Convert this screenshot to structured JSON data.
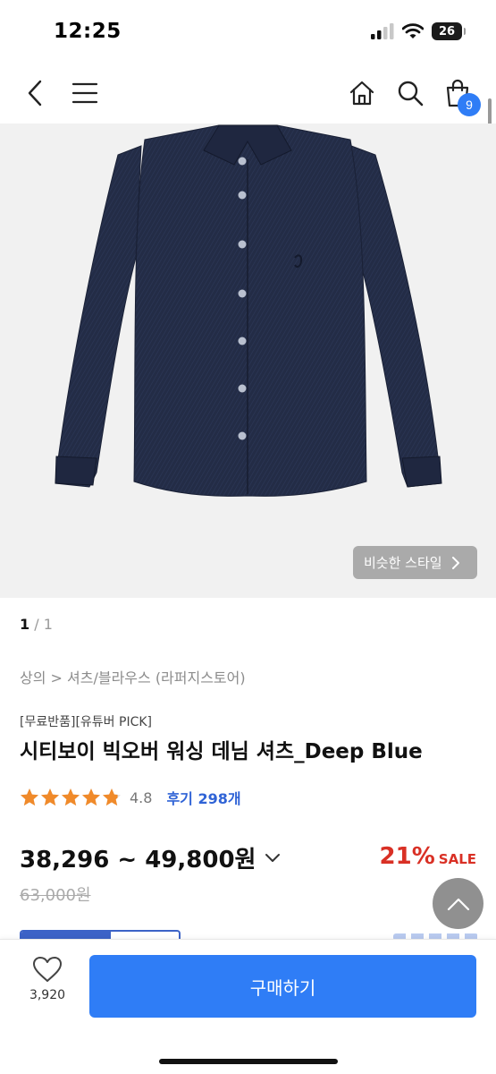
{
  "status_bar": {
    "time": "12:25",
    "battery": "26",
    "icons": [
      "signal-icon",
      "wifi-icon",
      "battery-icon"
    ]
  },
  "nav": {
    "icons": [
      "back-icon",
      "menu-icon",
      "home-icon",
      "search-icon",
      "cart-icon"
    ],
    "cart_count": "9"
  },
  "product": {
    "image": "navy-denim-shirt-photo",
    "similar_style_label": "비슷한 스타일",
    "pager_current": "1",
    "pager_total": "/ 1",
    "breadcrumb": "상의 > 셔츠/블라우스 (라퍼지스토어)",
    "tags": "[무료반품][유튜버 PICK]",
    "title": "시티보이 빅오버 워싱 데님 셔츠_Deep Blue",
    "rating": 4.8,
    "rating_text": "4.8",
    "review_link": "후기 298개",
    "price_range": "38,296 ~ 49,800원",
    "original_price": "63,000원",
    "discount_percent": "21%",
    "discount_label": "SALE"
  },
  "bottom_bar": {
    "like_count": "3,920",
    "buy_label": "구매하기"
  },
  "colors": {
    "accent": "#2f7df6",
    "review_link": "#2f63d6",
    "sale": "#d93025",
    "star": "#f08a2a",
    "shirt": "#232c46"
  }
}
